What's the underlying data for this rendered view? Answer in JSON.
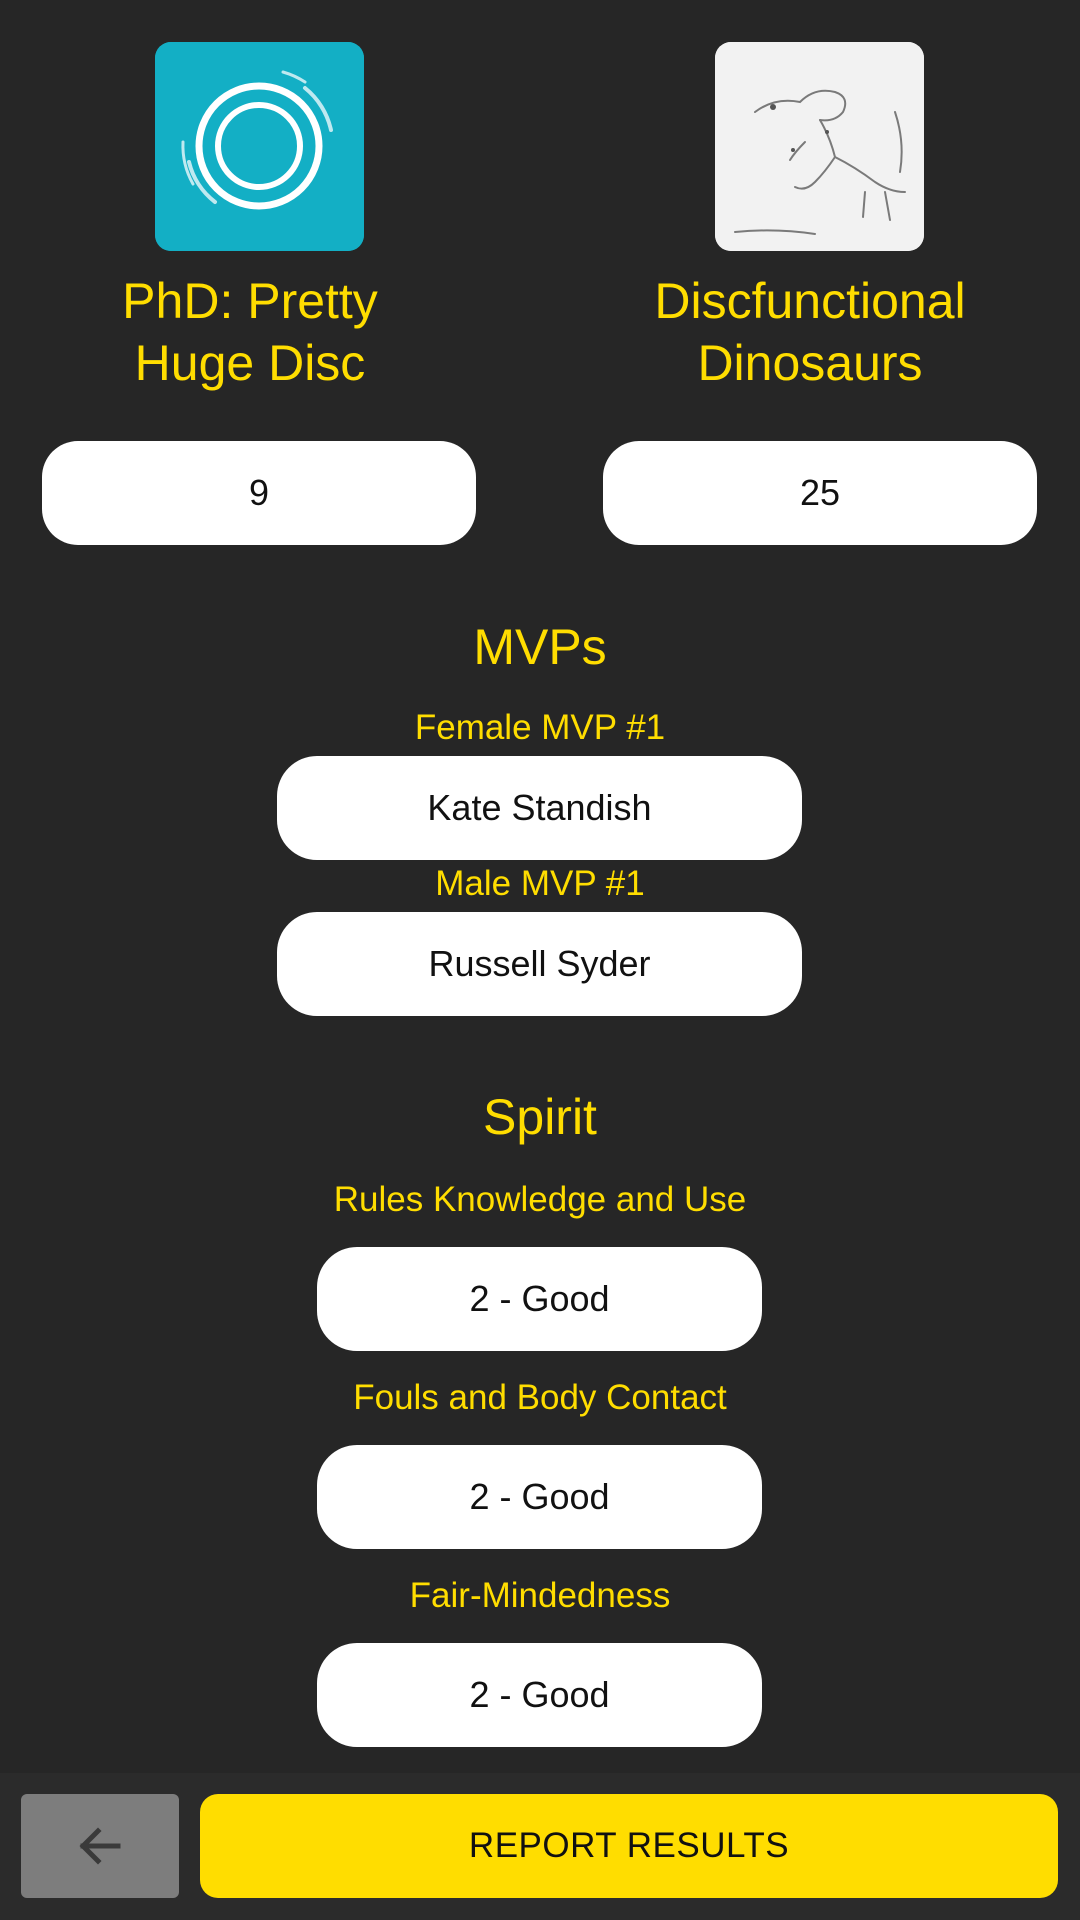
{
  "teams": {
    "left": {
      "name": "PhD: Pretty\nHuge Disc",
      "score": "9",
      "logo_icon": "spinning-disc-logo"
    },
    "right": {
      "name": "Discfunctional\nDinosaurs",
      "score": "25",
      "logo_icon": "dinosaur-sketch-logo"
    }
  },
  "mvps": {
    "title": "MVPs",
    "female_label": "Female MVP #1",
    "female_value": "Kate Standish",
    "male_label": "Male MVP #1",
    "male_value": "Russell Syder"
  },
  "spirit": {
    "title": "Spirit",
    "items": [
      {
        "label": "Rules Knowledge and Use",
        "value": "2 - Good"
      },
      {
        "label": "Fouls and Body Contact",
        "value": "2 - Good"
      },
      {
        "label": "Fair-Mindedness",
        "value": "2 - Good"
      }
    ]
  },
  "footer": {
    "back_icon": "arrow-left-icon",
    "report_label": "REPORT RESULTS"
  },
  "colors": {
    "background": "#262626",
    "accent": "#FFDD00",
    "back_button": "#7d7d7d",
    "left_logo": "#13AFC5"
  }
}
